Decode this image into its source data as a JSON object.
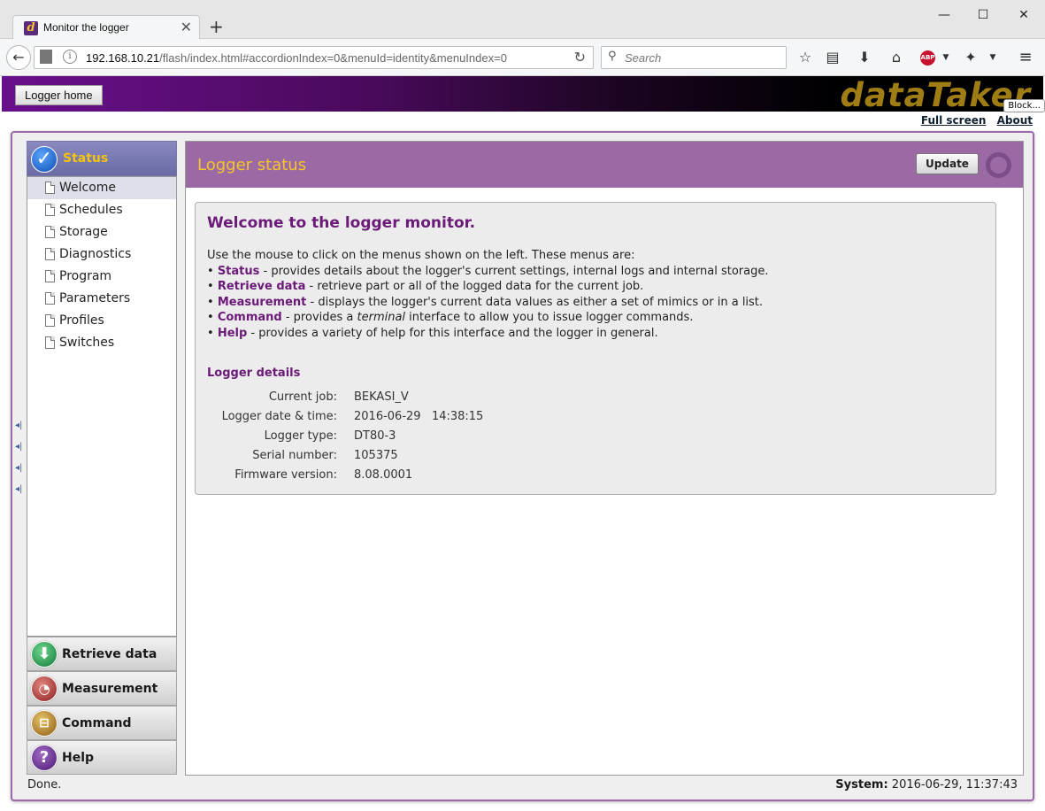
{
  "browser": {
    "tab_title": "Monitor the logger",
    "tab_favicon_letter": "d",
    "url_host": "192.168.10.21",
    "url_path": "/flash/index.html#accordionIndex=0&menuId=identity&menuIndex=0",
    "search_placeholder": "Search"
  },
  "header": {
    "home_button": "Logger home",
    "brand": "dataTaker",
    "block_tip": "Block...",
    "link_fullscreen": "Full screen",
    "link_about": "About"
  },
  "sidebar": {
    "status_label": "Status",
    "items": [
      {
        "label": "Welcome"
      },
      {
        "label": "Schedules"
      },
      {
        "label": "Storage"
      },
      {
        "label": "Diagnostics"
      },
      {
        "label": "Program"
      },
      {
        "label": "Parameters"
      },
      {
        "label": "Profiles"
      },
      {
        "label": "Switches"
      }
    ],
    "panels": [
      {
        "label": "Retrieve data"
      },
      {
        "label": "Measurement"
      },
      {
        "label": "Command"
      },
      {
        "label": "Help"
      }
    ]
  },
  "main": {
    "title": "Logger status",
    "update_button": "Update",
    "welcome_title": "Welcome to the logger monitor.",
    "intro": "Use the mouse to click on the menus shown on the left. These menus are:",
    "bullets": [
      {
        "term": "Status",
        "text": " - provides details about the logger's current settings, internal logs and internal storage."
      },
      {
        "term": "Retrieve data",
        "text": " - retrieve part or all of the logged data for the current job."
      },
      {
        "term": "Measurement",
        "text": " - displays the logger's current data values as either a set of mimics or in a list."
      },
      {
        "term": "Command",
        "text_before": " - provides a ",
        "text_em": "terminal",
        "text_after": " interface to allow you to issue logger commands."
      },
      {
        "term": "Help",
        "text": " - provides a variety of help for this interface and the logger in general."
      }
    ],
    "details_title": "Logger details",
    "details": [
      {
        "label": "Current job:",
        "value": "BEKASI_V"
      },
      {
        "label": "Logger date & time:",
        "value": "2016-06-29   14:38:15"
      },
      {
        "label": "Logger type:",
        "value": "DT80-3"
      },
      {
        "label": "Serial number:",
        "value": "105375"
      },
      {
        "label": "Firmware version:",
        "value": "8.08.0001"
      }
    ]
  },
  "statusbar": {
    "left": "Done.",
    "system_label": "System:",
    "system_value": "2016-06-29, 11:37:43"
  }
}
